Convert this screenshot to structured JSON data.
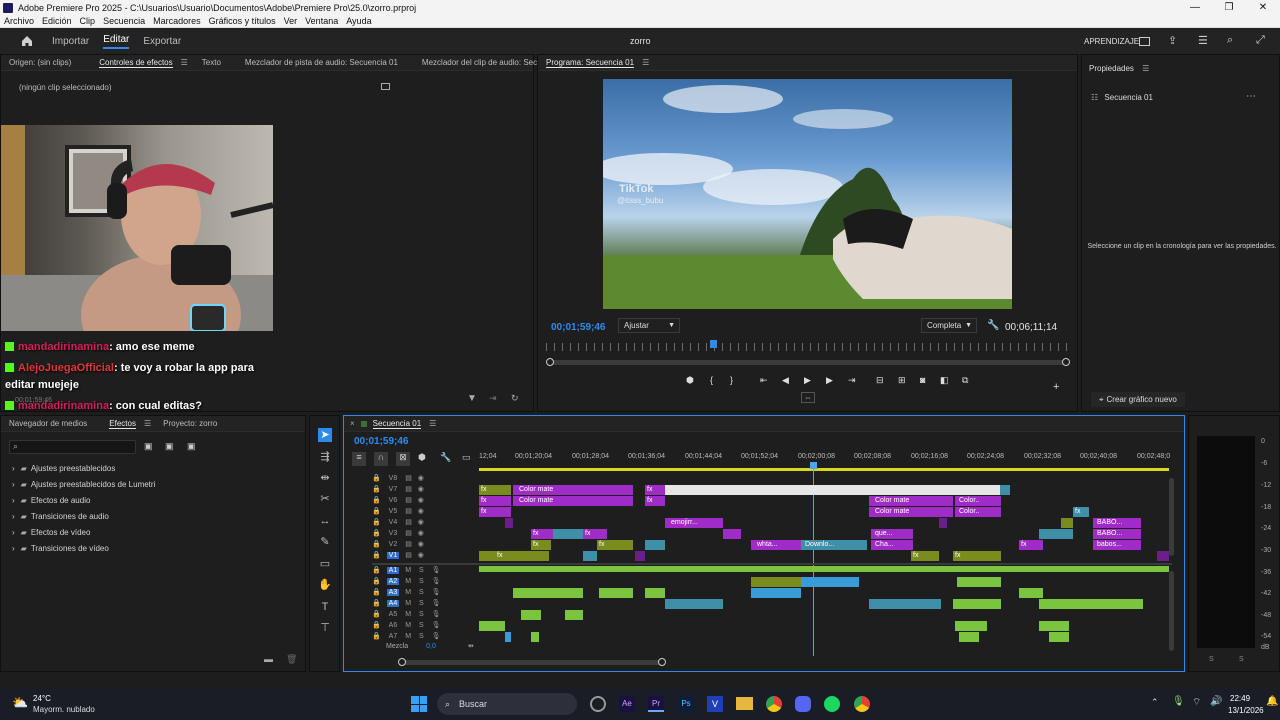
{
  "window": {
    "title": "Adobe Premiere Pro 2025 - C:\\Usuarios\\Usuario\\Documentos\\Adobe\\Premiere Pro\\25.0\\zorro.prproj",
    "controls": [
      "—",
      "❐",
      "✕"
    ]
  },
  "menu": [
    "Archivo",
    "Edición",
    "Clip",
    "Secuencia",
    "Marcadores",
    "Gráficos y títulos",
    "Ver",
    "Ventana",
    "Ayuda"
  ],
  "workspace": {
    "tabs": [
      "Importar",
      "Editar",
      "Exportar"
    ],
    "project_name": "zorro",
    "learning": "APRENDIZAJE"
  },
  "source_panel": {
    "tabs": [
      "Origen: (sin clips)",
      "Controles de efectos",
      "Texto",
      "Mezclador de pista de audio: Secuencia 01",
      "Mezclador del clip de audio: Secuenc"
    ],
    "no_clip": "(ningún clip seleccionado)",
    "timecode": "00;01;59;46"
  },
  "chat": [
    {
      "user": "mandadirinamina",
      "message": ": amo ese meme"
    },
    {
      "user": "AlejoJuegaOfficial",
      "message": ": te voy a robar la app para"
    },
    {
      "user": "",
      "message": "editar muejeje"
    },
    {
      "user": "mandadirinamina",
      "message": ": con cual editas?"
    }
  ],
  "program_panel": {
    "title": "Programa: Secuencia 01",
    "timecode": "00;01;59;46",
    "fit": "Ajustar",
    "quality": "Completa",
    "duration": "00;06;11;14",
    "video_overlay": "TikTok",
    "video_user": "@itsss_bubu"
  },
  "properties_panel": {
    "title": "Propiedades",
    "sequence": "Secuencia 01",
    "hint": "Seleccione un clip en la cronología para ver las propiedades.",
    "new_graphic": "Crear gráfico nuevo"
  },
  "effects_panel": {
    "tabs": [
      "Navegador de medios",
      "Efectos",
      "Proyecto: zorro"
    ],
    "items": [
      "Ajustes preestablecidos",
      "Ajustes preestablecidos de Lumetri",
      "Efectos de audio",
      "Transiciones de audio",
      "Efectos de vídeo",
      "Transiciones de vídeo"
    ]
  },
  "timeline": {
    "tab": "Secuencia 01",
    "timecode": "00;01;59;46",
    "ruler": [
      "12;04",
      "00;01;20;04",
      "00;01;28;04",
      "00;01;36;04",
      "00;01;44;04",
      "00;01;52;04",
      "00;02;00;08",
      "00;02;08;08",
      "00;02;16;08",
      "00;02;24;08",
      "00;02;32;08",
      "00;02;40;08",
      "00;02;48;0"
    ],
    "video_tracks": [
      "V8",
      "V7",
      "V6",
      "V5",
      "V4",
      "V3",
      "V2",
      "V1"
    ],
    "audio_tracks": [
      "A1",
      "A2",
      "A3",
      "A4",
      "A5",
      "A6",
      "A7"
    ],
    "mix_label": "Mezcla",
    "mix_value": "0,0",
    "clip_labels": {
      "color_mate": "Color mate",
      "color_short": "Color..",
      "emojirr": "emojirr...",
      "whta": "whta...",
      "downlo": "Downlo...",
      "que": "que...",
      "cha": "Cha...",
      "babo": "BABO...",
      "babos": "babos...",
      "fx": "fx"
    }
  },
  "meter": {
    "scale": [
      "0",
      "-6",
      "-12",
      "-18",
      "-24",
      "-30",
      "-36",
      "-42",
      "-48",
      "-54",
      "dB"
    ],
    "solo": [
      "S",
      "S"
    ]
  },
  "taskbar": {
    "temp": "24°C",
    "weather": "Mayorm. nublado",
    "search": "Buscar",
    "time": "22:49",
    "date": "13/1/2026"
  }
}
